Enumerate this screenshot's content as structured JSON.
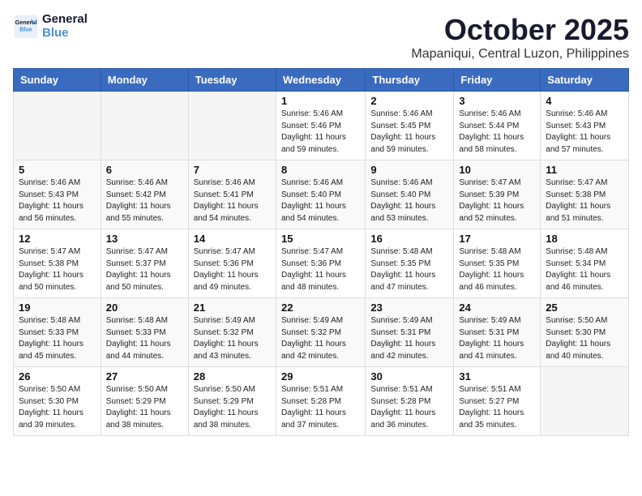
{
  "header": {
    "logo_line1": "General",
    "logo_line2": "Blue",
    "month": "October 2025",
    "location": "Mapaniqui, Central Luzon, Philippines"
  },
  "weekdays": [
    "Sunday",
    "Monday",
    "Tuesday",
    "Wednesday",
    "Thursday",
    "Friday",
    "Saturday"
  ],
  "weeks": [
    [
      {
        "day": "",
        "sunrise": "",
        "sunset": "",
        "daylight": ""
      },
      {
        "day": "",
        "sunrise": "",
        "sunset": "",
        "daylight": ""
      },
      {
        "day": "",
        "sunrise": "",
        "sunset": "",
        "daylight": ""
      },
      {
        "day": "1",
        "sunrise": "Sunrise: 5:46 AM",
        "sunset": "Sunset: 5:46 PM",
        "daylight": "Daylight: 11 hours and 59 minutes."
      },
      {
        "day": "2",
        "sunrise": "Sunrise: 5:46 AM",
        "sunset": "Sunset: 5:45 PM",
        "daylight": "Daylight: 11 hours and 59 minutes."
      },
      {
        "day": "3",
        "sunrise": "Sunrise: 5:46 AM",
        "sunset": "Sunset: 5:44 PM",
        "daylight": "Daylight: 11 hours and 58 minutes."
      },
      {
        "day": "4",
        "sunrise": "Sunrise: 5:46 AM",
        "sunset": "Sunset: 5:43 PM",
        "daylight": "Daylight: 11 hours and 57 minutes."
      }
    ],
    [
      {
        "day": "5",
        "sunrise": "Sunrise: 5:46 AM",
        "sunset": "Sunset: 5:43 PM",
        "daylight": "Daylight: 11 hours and 56 minutes."
      },
      {
        "day": "6",
        "sunrise": "Sunrise: 5:46 AM",
        "sunset": "Sunset: 5:42 PM",
        "daylight": "Daylight: 11 hours and 55 minutes."
      },
      {
        "day": "7",
        "sunrise": "Sunrise: 5:46 AM",
        "sunset": "Sunset: 5:41 PM",
        "daylight": "Daylight: 11 hours and 54 minutes."
      },
      {
        "day": "8",
        "sunrise": "Sunrise: 5:46 AM",
        "sunset": "Sunset: 5:40 PM",
        "daylight": "Daylight: 11 hours and 54 minutes."
      },
      {
        "day": "9",
        "sunrise": "Sunrise: 5:46 AM",
        "sunset": "Sunset: 5:40 PM",
        "daylight": "Daylight: 11 hours and 53 minutes."
      },
      {
        "day": "10",
        "sunrise": "Sunrise: 5:47 AM",
        "sunset": "Sunset: 5:39 PM",
        "daylight": "Daylight: 11 hours and 52 minutes."
      },
      {
        "day": "11",
        "sunrise": "Sunrise: 5:47 AM",
        "sunset": "Sunset: 5:38 PM",
        "daylight": "Daylight: 11 hours and 51 minutes."
      }
    ],
    [
      {
        "day": "12",
        "sunrise": "Sunrise: 5:47 AM",
        "sunset": "Sunset: 5:38 PM",
        "daylight": "Daylight: 11 hours and 50 minutes."
      },
      {
        "day": "13",
        "sunrise": "Sunrise: 5:47 AM",
        "sunset": "Sunset: 5:37 PM",
        "daylight": "Daylight: 11 hours and 50 minutes."
      },
      {
        "day": "14",
        "sunrise": "Sunrise: 5:47 AM",
        "sunset": "Sunset: 5:36 PM",
        "daylight": "Daylight: 11 hours and 49 minutes."
      },
      {
        "day": "15",
        "sunrise": "Sunrise: 5:47 AM",
        "sunset": "Sunset: 5:36 PM",
        "daylight": "Daylight: 11 hours and 48 minutes."
      },
      {
        "day": "16",
        "sunrise": "Sunrise: 5:48 AM",
        "sunset": "Sunset: 5:35 PM",
        "daylight": "Daylight: 11 hours and 47 minutes."
      },
      {
        "day": "17",
        "sunrise": "Sunrise: 5:48 AM",
        "sunset": "Sunset: 5:35 PM",
        "daylight": "Daylight: 11 hours and 46 minutes."
      },
      {
        "day": "18",
        "sunrise": "Sunrise: 5:48 AM",
        "sunset": "Sunset: 5:34 PM",
        "daylight": "Daylight: 11 hours and 46 minutes."
      }
    ],
    [
      {
        "day": "19",
        "sunrise": "Sunrise: 5:48 AM",
        "sunset": "Sunset: 5:33 PM",
        "daylight": "Daylight: 11 hours and 45 minutes."
      },
      {
        "day": "20",
        "sunrise": "Sunrise: 5:48 AM",
        "sunset": "Sunset: 5:33 PM",
        "daylight": "Daylight: 11 hours and 44 minutes."
      },
      {
        "day": "21",
        "sunrise": "Sunrise: 5:49 AM",
        "sunset": "Sunset: 5:32 PM",
        "daylight": "Daylight: 11 hours and 43 minutes."
      },
      {
        "day": "22",
        "sunrise": "Sunrise: 5:49 AM",
        "sunset": "Sunset: 5:32 PM",
        "daylight": "Daylight: 11 hours and 42 minutes."
      },
      {
        "day": "23",
        "sunrise": "Sunrise: 5:49 AM",
        "sunset": "Sunset: 5:31 PM",
        "daylight": "Daylight: 11 hours and 42 minutes."
      },
      {
        "day": "24",
        "sunrise": "Sunrise: 5:49 AM",
        "sunset": "Sunset: 5:31 PM",
        "daylight": "Daylight: 11 hours and 41 minutes."
      },
      {
        "day": "25",
        "sunrise": "Sunrise: 5:50 AM",
        "sunset": "Sunset: 5:30 PM",
        "daylight": "Daylight: 11 hours and 40 minutes."
      }
    ],
    [
      {
        "day": "26",
        "sunrise": "Sunrise: 5:50 AM",
        "sunset": "Sunset: 5:30 PM",
        "daylight": "Daylight: 11 hours and 39 minutes."
      },
      {
        "day": "27",
        "sunrise": "Sunrise: 5:50 AM",
        "sunset": "Sunset: 5:29 PM",
        "daylight": "Daylight: 11 hours and 38 minutes."
      },
      {
        "day": "28",
        "sunrise": "Sunrise: 5:50 AM",
        "sunset": "Sunset: 5:29 PM",
        "daylight": "Daylight: 11 hours and 38 minutes."
      },
      {
        "day": "29",
        "sunrise": "Sunrise: 5:51 AM",
        "sunset": "Sunset: 5:28 PM",
        "daylight": "Daylight: 11 hours and 37 minutes."
      },
      {
        "day": "30",
        "sunrise": "Sunrise: 5:51 AM",
        "sunset": "Sunset: 5:28 PM",
        "daylight": "Daylight: 11 hours and 36 minutes."
      },
      {
        "day": "31",
        "sunrise": "Sunrise: 5:51 AM",
        "sunset": "Sunset: 5:27 PM",
        "daylight": "Daylight: 11 hours and 35 minutes."
      },
      {
        "day": "",
        "sunrise": "",
        "sunset": "",
        "daylight": ""
      }
    ]
  ]
}
